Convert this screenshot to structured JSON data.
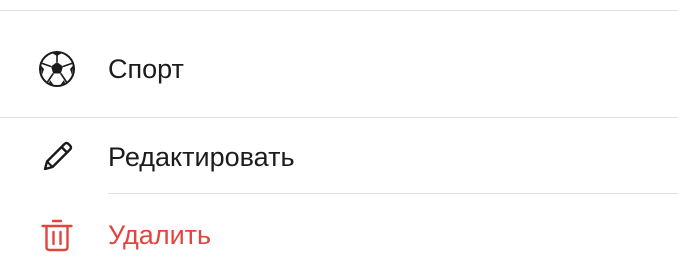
{
  "menu": {
    "items": [
      {
        "label": "Спорт",
        "icon": "soccer-ball-icon",
        "color": "#1c1c1e"
      },
      {
        "label": "Редактировать",
        "icon": "pencil-icon",
        "color": "#1c1c1e"
      },
      {
        "label": "Удалить",
        "icon": "trash-icon",
        "color": "#e0463f"
      }
    ],
    "separator_color": "#e2e2e2",
    "background": "#ffffff"
  }
}
